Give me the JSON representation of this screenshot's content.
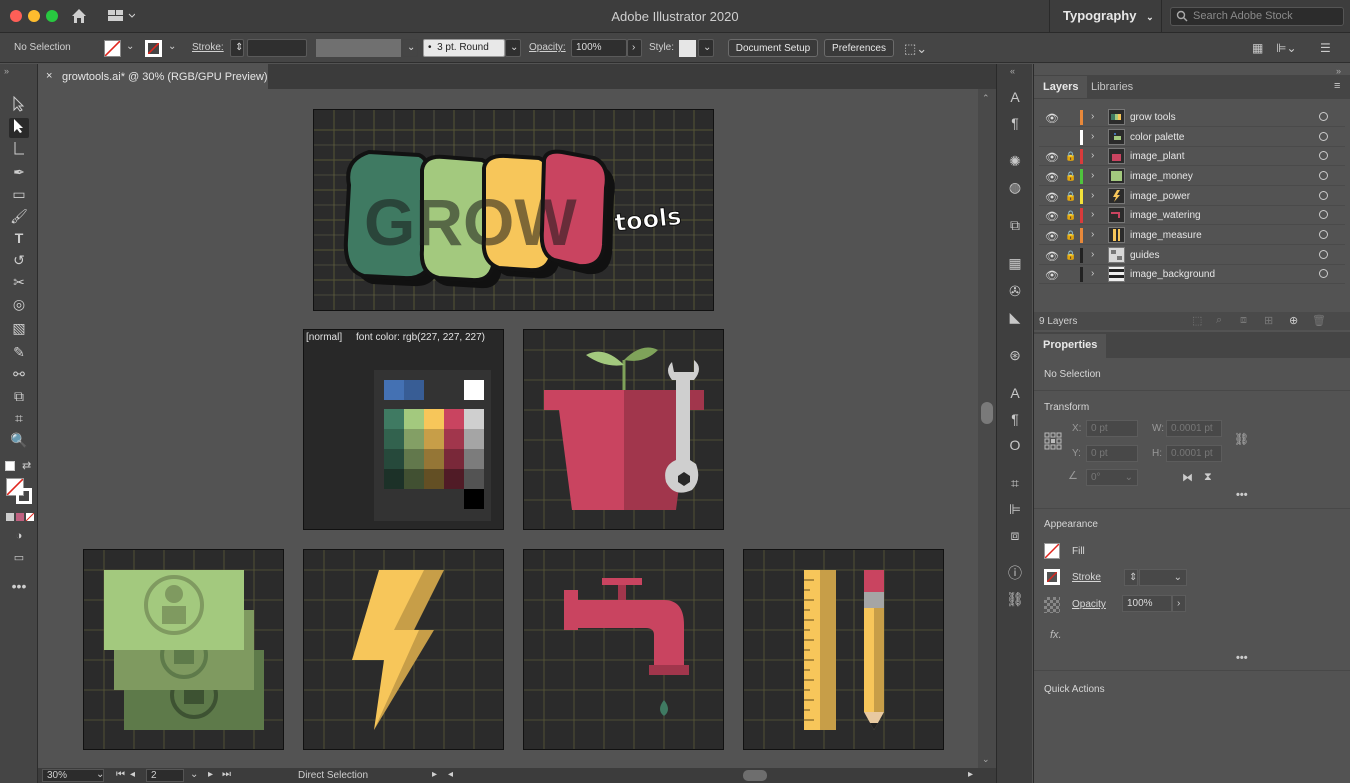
{
  "window": {
    "title": "Adobe Illustrator 2020",
    "workspace": "Typography",
    "search_placeholder": "Search Adobe Stock"
  },
  "control_bar": {
    "selection": "No Selection",
    "stroke_label": "Stroke:",
    "brush": "3 pt. Round",
    "opacity_label": "Opacity:",
    "opacity_value": "100%",
    "style_label": "Style:",
    "document_setup": "Document Setup",
    "preferences": "Preferences"
  },
  "document_tab": {
    "title": "growtools.ai* @ 30% (RGB/GPU Preview)"
  },
  "canvas": {
    "palette_note": "[normal]     font color: rgb(227, 227, 227)",
    "logo_text": "GROW",
    "logo_sub": "tools"
  },
  "status_bar": {
    "zoom": "30%",
    "artboard": "2",
    "tool": "Direct Selection"
  },
  "layers_panel": {
    "tabs": [
      "Layers",
      "Libraries"
    ],
    "layers": [
      {
        "name": "grow tools",
        "color": "#e8883a",
        "locked": false
      },
      {
        "name": "color palette",
        "color": "#ffffff",
        "locked": false
      },
      {
        "name": "image_plant",
        "color": "#d93b3b",
        "locked": true
      },
      {
        "name": "image_money",
        "color": "#4fc43d",
        "locked": true
      },
      {
        "name": "image_power",
        "color": "#f2e23a",
        "locked": true
      },
      {
        "name": "image_watering",
        "color": "#d93b3b",
        "locked": true
      },
      {
        "name": "image_measure",
        "color": "#e8883a",
        "locked": true
      },
      {
        "name": "guides",
        "color": "#222222",
        "locked": true
      },
      {
        "name": "image_background",
        "color": "#222222",
        "locked": false
      }
    ],
    "count": "9 Layers"
  },
  "properties_panel": {
    "tab": "Properties",
    "selection": "No Selection",
    "transform_title": "Transform",
    "x_label": "X:",
    "x_value": "0 pt",
    "y_label": "Y:",
    "y_value": "0 pt",
    "w_label": "W:",
    "w_value": "0.0001 pt",
    "h_label": "H:",
    "h_value": "0.0001 pt",
    "angle_value": "0°",
    "appearance_title": "Appearance",
    "fill_label": "Fill",
    "stroke_label": "Stroke",
    "opacity_label": "Opacity",
    "opacity_value": "100%",
    "fx_label": "fx.",
    "quick_actions_title": "Quick Actions"
  },
  "colors": {
    "green_dark": "#3f7a62",
    "green_light": "#a3c97e",
    "yellow": "#f7c65a",
    "pink": "#c94460",
    "gray": "#cfcfcf"
  }
}
